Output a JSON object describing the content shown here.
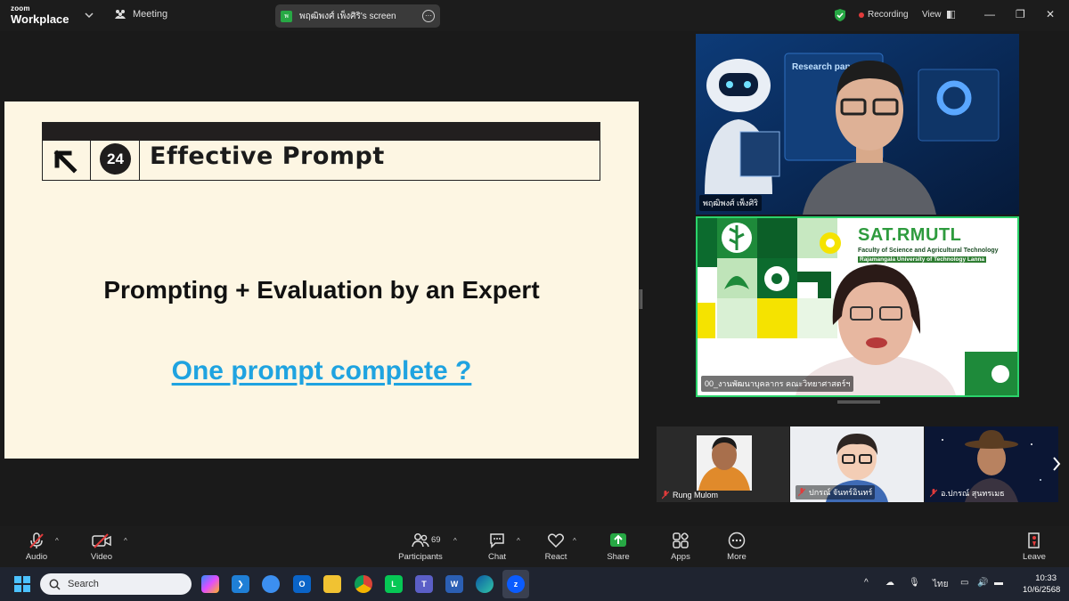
{
  "topbar": {
    "logo_line1": "zoom",
    "logo_line2": "Workplace",
    "meeting_label": "Meeting",
    "shared_screen_label": "พฤฒิพงศ์ เพ็งศิริ's screen",
    "shared_screen_badge": "พ",
    "recording_label": "Recording",
    "view_label": "View"
  },
  "slide": {
    "badge_number": "24",
    "header_title": "Effective Prompt",
    "main_text": "Prompting + Evaluation by an Expert",
    "link_text": "One prompt complete ?"
  },
  "videos": [
    {
      "name": "พฤฒิพงศ์ เพ็งศิริ",
      "screen_text": "Research paper"
    },
    {
      "name": "00_งานพัฒนาบุคลากร คณะวิทยาศาสตร์ฯ",
      "banner_title": "SAT.RMUTL",
      "banner_sub1": "Faculty of Science and Agricultural Technology",
      "banner_sub2": "Rajamangala University of Technology Lanna"
    }
  ],
  "participants": [
    {
      "name": "Rung Mulom"
    },
    {
      "name": "ปกรณ์ จันทร์อินทร์"
    },
    {
      "name": "อ.ปกรณ์ สุนทรเมธ"
    }
  ],
  "toolbar": {
    "audio": "Audio",
    "video": "Video",
    "participants": "Participants",
    "participant_count": "69",
    "chat": "Chat",
    "react": "React",
    "share": "Share",
    "apps": "Apps",
    "more": "More",
    "leave": "Leave"
  },
  "taskbar": {
    "search_placeholder": "Search",
    "language": "ไทย",
    "time": "10:33",
    "date": "10/6/2568"
  },
  "colors": {
    "slide_bg": "#fdf6e3",
    "link": "#1fa3e0",
    "share_green": "#27a844",
    "record_red": "#e23b3b",
    "active_speaker_border": "#2bd36b"
  }
}
